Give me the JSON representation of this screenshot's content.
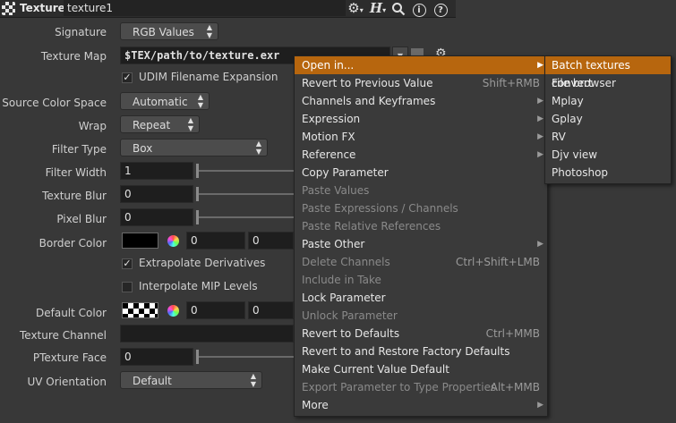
{
  "header": {
    "node_type": "Texture",
    "node_name": "texture1",
    "icons": [
      "gear-icon",
      "houdini-h-icon",
      "search-icon",
      "info-icon",
      "help-icon"
    ]
  },
  "params": {
    "signature": {
      "label": "Signature",
      "value": "RGB Values"
    },
    "texture_map": {
      "label": "Texture Map",
      "value": "$TEX/path/to/texture.exr"
    },
    "udim": {
      "label": "UDIM Filename Expansion",
      "checked": true
    },
    "source_color_space": {
      "label": "Source Color Space",
      "value": "Automatic"
    },
    "wrap": {
      "label": "Wrap",
      "value": "Repeat"
    },
    "filter_type": {
      "label": "Filter Type",
      "value": "Box"
    },
    "filter_width": {
      "label": "Filter Width",
      "value": "1"
    },
    "texture_blur": {
      "label": "Texture Blur",
      "value": "0"
    },
    "pixel_blur": {
      "label": "Pixel Blur",
      "value": "0"
    },
    "border_color": {
      "label": "Border Color",
      "r": "0",
      "g": "0",
      "swatch": "#000000"
    },
    "extrapolate": {
      "label": "Extrapolate Derivatives",
      "checked": true
    },
    "interpolate_mip": {
      "label": "Interpolate MIP Levels",
      "checked": false
    },
    "default_color": {
      "label": "Default Color",
      "r": "0",
      "g": "0"
    },
    "texture_channel": {
      "label": "Texture Channel",
      "value": ""
    },
    "ptexture_face": {
      "label": "PTexture Face",
      "value": "0"
    },
    "uv_orientation": {
      "label": "UV Orientation",
      "value": "Default"
    }
  },
  "menu": {
    "items": [
      {
        "label": "Open in...",
        "shortcut": "",
        "submenu": true,
        "disabled": false,
        "highlighted": true
      },
      {
        "label": "Revert to Previous Value",
        "shortcut": "Shift+RMB",
        "submenu": false,
        "disabled": false
      },
      {
        "label": "Channels and Keyframes",
        "shortcut": "",
        "submenu": true,
        "disabled": false
      },
      {
        "label": "Expression",
        "shortcut": "",
        "submenu": true,
        "disabled": false
      },
      {
        "label": "Motion FX",
        "shortcut": "",
        "submenu": true,
        "disabled": false
      },
      {
        "label": "Reference",
        "shortcut": "",
        "submenu": true,
        "disabled": false
      },
      {
        "label": "Copy Parameter",
        "shortcut": "",
        "submenu": false,
        "disabled": false
      },
      {
        "label": "Paste Values",
        "shortcut": "",
        "submenu": false,
        "disabled": true
      },
      {
        "label": "Paste Expressions / Channels",
        "shortcut": "",
        "submenu": false,
        "disabled": true
      },
      {
        "label": "Paste Relative References",
        "shortcut": "",
        "submenu": false,
        "disabled": true
      },
      {
        "label": "Paste Other",
        "shortcut": "",
        "submenu": true,
        "disabled": false
      },
      {
        "label": "Delete Channels",
        "shortcut": "Ctrl+Shift+LMB",
        "submenu": false,
        "disabled": true
      },
      {
        "label": "Include in Take",
        "shortcut": "",
        "submenu": false,
        "disabled": true
      },
      {
        "label": "Lock Parameter",
        "shortcut": "",
        "submenu": false,
        "disabled": false
      },
      {
        "label": "Unlock Parameter",
        "shortcut": "",
        "submenu": false,
        "disabled": true
      },
      {
        "label": "Revert to Defaults",
        "shortcut": "Ctrl+MMB",
        "submenu": false,
        "disabled": false
      },
      {
        "label": "Revert to and Restore Factory Defaults",
        "shortcut": "",
        "submenu": false,
        "disabled": false
      },
      {
        "label": "Make Current Value Default",
        "shortcut": "",
        "submenu": false,
        "disabled": false
      },
      {
        "label": "Export Parameter to Type Properties",
        "shortcut": "Alt+MMB",
        "submenu": false,
        "disabled": true
      },
      {
        "label": "More",
        "shortcut": "",
        "submenu": true,
        "disabled": false
      }
    ]
  },
  "submenu": {
    "items": [
      {
        "label": "Batch textures convert",
        "highlighted": true
      },
      {
        "label": "File browser"
      },
      {
        "label": "Mplay"
      },
      {
        "label": "Gplay"
      },
      {
        "label": "RV"
      },
      {
        "label": "Djv view"
      },
      {
        "label": "Photoshop"
      }
    ]
  },
  "colors": {
    "highlight": "#b7660e",
    "background": "#383838"
  }
}
